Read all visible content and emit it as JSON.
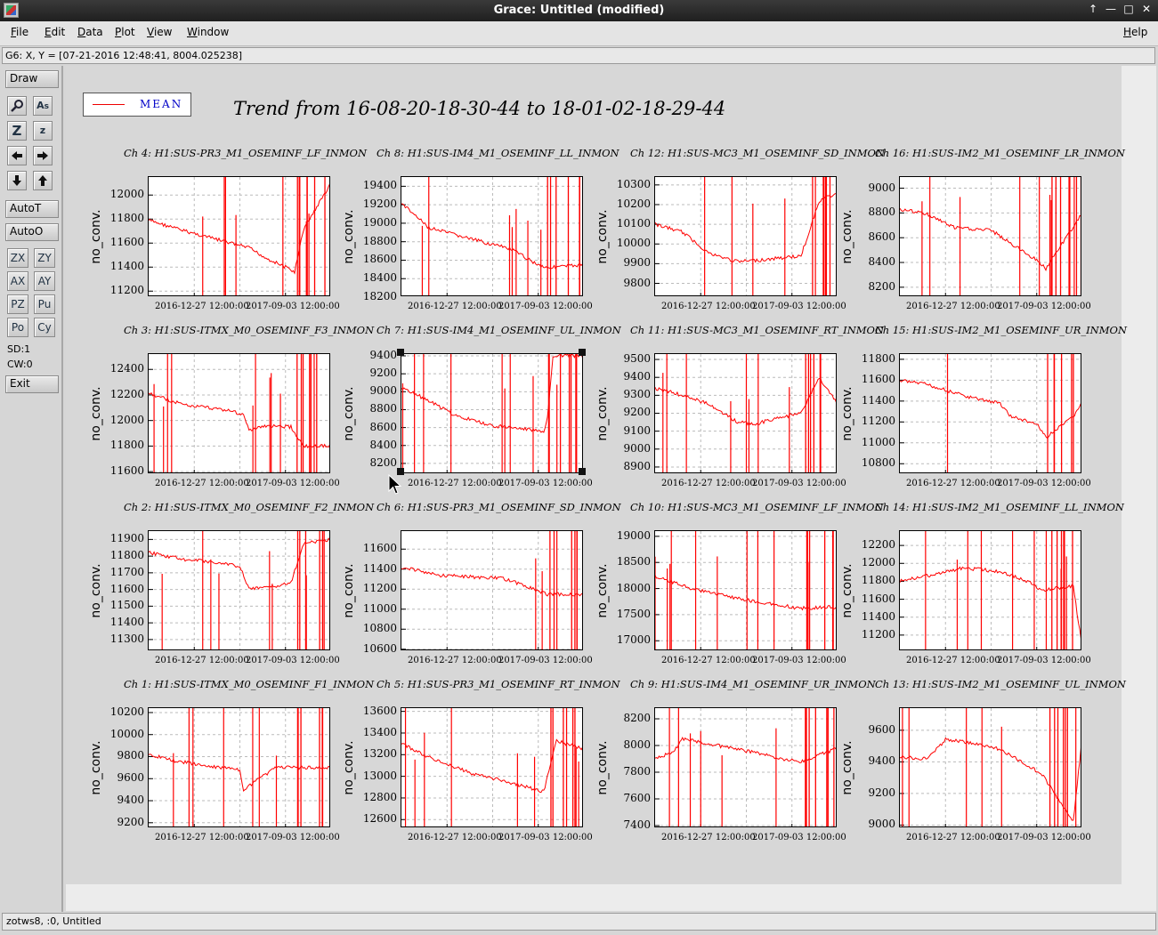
{
  "window": {
    "title": "Grace: Untitled (modified)",
    "controls": [
      "↑",
      "—",
      "□",
      "✕"
    ]
  },
  "menubar": {
    "items": [
      "File",
      "Edit",
      "Data",
      "Plot",
      "View",
      "Window"
    ],
    "help": "Help"
  },
  "locator": {
    "text": "G6: X, Y = [07-21-2016 12:48:41, 8004.025238]"
  },
  "toolpanel": {
    "draw": "Draw",
    "autot": "AutoT",
    "autoo": "AutoO",
    "btn_zx": "ZX",
    "btn_zy": "ZY",
    "btn_ax": "AX",
    "btn_ay": "AY",
    "btn_pz": "PZ",
    "btn_pu": "Pu",
    "btn_po": "Po",
    "btn_cy": "Cy",
    "sd": "SD:1",
    "cw": "CW:0",
    "exit": "Exit"
  },
  "legend": {
    "label": "MEAN"
  },
  "plot_title": "Trend from 16-08-20-18-30-44 to 18-01-02-18-29-44",
  "ylabel": "no_conv.",
  "xticks": [
    "2016-12-27 12:00:00",
    "2017-09-03 12:00:00"
  ],
  "status": {
    "text": "zotws8, :0, Untitled"
  },
  "colors": {
    "series": "#ff0000",
    "title_bg": "#262626",
    "legend_text": "#0000c8"
  },
  "chart_data": [
    {
      "type": "line",
      "title": "Ch 4: H1:SUS-PR3_M1_OSEMINF_LF_INMON",
      "ylabel": "no_conv.",
      "yticks": [
        "12000",
        "11800",
        "11600",
        "11400",
        "11200"
      ],
      "ylim": [
        11150,
        12150
      ],
      "series": [
        {
          "name": "MEAN",
          "x": [
            0,
            0.2,
            0.4,
            0.55,
            0.65,
            0.75,
            0.8,
            0.85,
            1
          ],
          "values": [
            11790,
            11700,
            11620,
            11560,
            11470,
            11400,
            11360,
            11720,
            12100
          ]
        }
      ]
    },
    {
      "type": "line",
      "title": "Ch 8: H1:SUS-IM4_M1_OSEMINF_LL_INMON",
      "ylabel": "no_conv.",
      "yticks": [
        "19400",
        "19200",
        "19000",
        "18800",
        "18600",
        "18400",
        "18200"
      ],
      "ylim": [
        18200,
        19500
      ],
      "series": [
        {
          "name": "MEAN",
          "x": [
            0,
            0.15,
            0.4,
            0.6,
            0.75,
            0.8,
            1
          ],
          "values": [
            19220,
            18950,
            18820,
            18720,
            18550,
            18520,
            18550
          ]
        }
      ]
    },
    {
      "type": "line",
      "title": "Ch 12: H1:SUS-MC3_M1_OSEMINF_SD_INMON",
      "ylabel": "no_conv.",
      "yticks": [
        "10300",
        "10200",
        "10100",
        "10000",
        "9900",
        "9800"
      ],
      "ylim": [
        9730,
        10340
      ],
      "series": [
        {
          "name": "MEAN",
          "x": [
            0,
            0.15,
            0.3,
            0.45,
            0.6,
            0.8,
            0.9,
            1
          ],
          "values": [
            10100,
            10060,
            9950,
            9910,
            9920,
            9940,
            10220,
            10260
          ]
        }
      ]
    },
    {
      "type": "line",
      "title": "Ch 16: H1:SUS-IM2_M1_OSEMINF_LR_INMON",
      "ylabel": "no_conv.",
      "yticks": [
        "9000",
        "8800",
        "8600",
        "8400",
        "8200"
      ],
      "ylim": [
        8120,
        9090
      ],
      "series": [
        {
          "name": "MEAN",
          "x": [
            0,
            0.15,
            0.3,
            0.5,
            0.6,
            0.75,
            0.8,
            1
          ],
          "values": [
            8830,
            8790,
            8680,
            8660,
            8560,
            8420,
            8350,
            8800
          ]
        }
      ]
    },
    {
      "type": "line",
      "title": "Ch 3: H1:SUS-ITMX_M0_OSEMINF_F3_INMON",
      "ylabel": "no_conv.",
      "yticks": [
        "12400",
        "12200",
        "12000",
        "11800",
        "11600"
      ],
      "ylim": [
        11580,
        12520
      ],
      "series": [
        {
          "name": "MEAN",
          "x": [
            0,
            0.2,
            0.4,
            0.52,
            0.55,
            0.65,
            0.78,
            0.85,
            1
          ],
          "values": [
            12210,
            12120,
            12090,
            12050,
            11920,
            11960,
            11950,
            11800,
            11800
          ]
        }
      ]
    },
    {
      "type": "line",
      "title": "Ch 7: H1:SUS-IM4_M1_OSEMINF_UL_INMON",
      "ylabel": "no_conv.",
      "yticks": [
        "9400",
        "9200",
        "9000",
        "8800",
        "8600",
        "8400",
        "8200"
      ],
      "ylim": [
        8080,
        9420
      ],
      "series": [
        {
          "name": "MEAN",
          "x": [
            0,
            0.15,
            0.3,
            0.5,
            0.7,
            0.78,
            0.8,
            0.83,
            1
          ],
          "values": [
            9050,
            8900,
            8730,
            8620,
            8580,
            8540,
            8700,
            9400,
            9400
          ]
        }
      ]
    },
    {
      "type": "line",
      "title": "Ch 11: H1:SUS-MC3_M1_OSEMINF_RT_INMON",
      "ylabel": "no_conv.",
      "yticks": [
        "9500",
        "9400",
        "9300",
        "9200",
        "9100",
        "9000",
        "8900"
      ],
      "ylim": [
        8860,
        9530
      ],
      "series": [
        {
          "name": "MEAN",
          "x": [
            0,
            0.15,
            0.3,
            0.45,
            0.55,
            0.7,
            0.8,
            0.9,
            1
          ],
          "values": [
            9340,
            9300,
            9250,
            9150,
            9140,
            9180,
            9200,
            9400,
            9250
          ]
        }
      ]
    },
    {
      "type": "line",
      "title": "Ch 15: H1:SUS-IM2_M1_OSEMINF_UR_INMON",
      "ylabel": "no_conv.",
      "yticks": [
        "11800",
        "11600",
        "11400",
        "11200",
        "11000",
        "10800"
      ],
      "ylim": [
        10700,
        11850
      ],
      "series": [
        {
          "name": "MEAN",
          "x": [
            0,
            0.15,
            0.35,
            0.55,
            0.6,
            0.75,
            0.8,
            0.95,
            1
          ],
          "values": [
            11600,
            11560,
            11450,
            11380,
            11260,
            11180,
            11050,
            11250,
            11400
          ]
        }
      ]
    },
    {
      "type": "line",
      "title": "Ch 2: H1:SUS-ITMX_M0_OSEMINF_F2_INMON",
      "ylabel": "no_conv.",
      "yticks": [
        "11900",
        "11800",
        "11700",
        "11600",
        "11500",
        "11400",
        "11300"
      ],
      "ylim": [
        11230,
        11950
      ],
      "series": [
        {
          "name": "MEAN",
          "x": [
            0,
            0.2,
            0.4,
            0.5,
            0.55,
            0.7,
            0.78,
            0.85,
            1
          ],
          "values": [
            11820,
            11780,
            11760,
            11740,
            11600,
            11620,
            11640,
            11880,
            11900
          ]
        }
      ]
    },
    {
      "type": "line",
      "title": "Ch 6: H1:SUS-PR3_M1_OSEMINF_SD_INMON",
      "ylabel": "no_conv.",
      "yticks": [
        "11600",
        "11400",
        "11200",
        "11000",
        "10800",
        "10600"
      ],
      "ylim": [
        10580,
        11780
      ],
      "series": [
        {
          "name": "MEAN",
          "x": [
            0,
            0.2,
            0.4,
            0.55,
            0.7,
            0.8,
            1
          ],
          "values": [
            11420,
            11340,
            11320,
            11310,
            11220,
            11150,
            11150
          ]
        }
      ]
    },
    {
      "type": "line",
      "title": "Ch 10: H1:SUS-MC3_M1_OSEMINF_LF_INMON",
      "ylabel": "no_conv.",
      "yticks": [
        "19000",
        "18500",
        "18000",
        "17500",
        "17000"
      ],
      "ylim": [
        16800,
        19100
      ],
      "series": [
        {
          "name": "MEAN",
          "x": [
            0,
            0.2,
            0.4,
            0.6,
            0.8,
            1
          ],
          "values": [
            18230,
            18000,
            17850,
            17720,
            17620,
            17650
          ]
        }
      ]
    },
    {
      "type": "line",
      "title": "Ch 14: H1:SUS-IM2_M1_OSEMINF_LL_INMON",
      "ylabel": "no_conv.",
      "yticks": [
        "12200",
        "12000",
        "11800",
        "11600",
        "11400",
        "11200"
      ],
      "ylim": [
        11020,
        12360
      ],
      "series": [
        {
          "name": "MEAN",
          "x": [
            0,
            0.2,
            0.35,
            0.55,
            0.7,
            0.78,
            0.95,
            1
          ],
          "values": [
            11800,
            11880,
            11950,
            11910,
            11800,
            11700,
            11750,
            11050
          ]
        }
      ]
    },
    {
      "type": "line",
      "title": "Ch 1: H1:SUS-ITMX_M0_OSEMINF_F1_INMON",
      "ylabel": "no_conv.",
      "yticks": [
        "10200",
        "10000",
        "9800",
        "9600",
        "9400",
        "9200"
      ],
      "ylim": [
        9150,
        10240
      ],
      "series": [
        {
          "name": "MEAN",
          "x": [
            0,
            0.15,
            0.3,
            0.5,
            0.52,
            0.7,
            1
          ],
          "values": [
            9820,
            9760,
            9720,
            9680,
            9500,
            9700,
            9700
          ]
        }
      ]
    },
    {
      "type": "line",
      "title": "Ch 5: H1:SUS-PR3_M1_OSEMINF_RT_INMON",
      "ylabel": "no_conv.",
      "yticks": [
        "13600",
        "13400",
        "13200",
        "13000",
        "12800",
        "12600"
      ],
      "ylim": [
        12520,
        13630
      ],
      "series": [
        {
          "name": "MEAN",
          "x": [
            0,
            0.2,
            0.4,
            0.6,
            0.78,
            0.85,
            1
          ],
          "values": [
            13300,
            13140,
            13020,
            12940,
            12860,
            13330,
            13250
          ]
        }
      ]
    },
    {
      "type": "line",
      "title": "Ch 9: H1:SUS-IM4_M1_OSEMINF_UR_INMON",
      "ylabel": "no_conv.",
      "yticks": [
        "8200",
        "8000",
        "7800",
        "7600",
        "7400"
      ],
      "ylim": [
        7380,
        8280
      ],
      "series": [
        {
          "name": "MEAN",
          "x": [
            0,
            0.1,
            0.15,
            0.3,
            0.5,
            0.7,
            0.8,
            1
          ],
          "values": [
            7900,
            7950,
            8050,
            8010,
            7960,
            7900,
            7880,
            7980
          ]
        }
      ]
    },
    {
      "type": "line",
      "title": "Ch 13: H1:SUS-IM2_M1_OSEMINF_UL_INMON",
      "ylabel": "no_conv.",
      "yticks": [
        "9600",
        "9400",
        "9200",
        "9000"
      ],
      "ylim": [
        8980,
        9740
      ],
      "series": [
        {
          "name": "MEAN",
          "x": [
            0,
            0.15,
            0.25,
            0.4,
            0.55,
            0.7,
            0.78,
            0.95,
            1
          ],
          "values": [
            9430,
            9420,
            9540,
            9520,
            9480,
            9380,
            9320,
            9020,
            9560
          ]
        }
      ]
    }
  ]
}
